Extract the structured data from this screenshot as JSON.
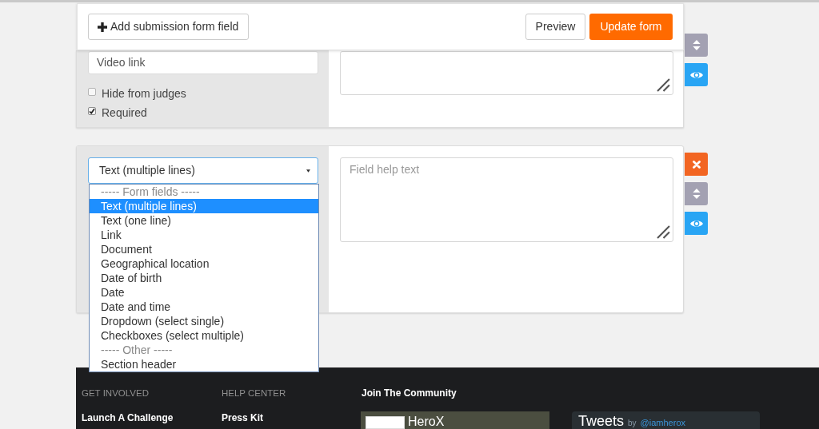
{
  "toolbar": {
    "add_field_button": "Add submission form field",
    "preview_button": "Preview",
    "update_button": "Update form"
  },
  "fields": [
    {
      "label_input": {
        "value": "Video link"
      },
      "settings": [
        {
          "label": "Hide from judges",
          "checked": false
        },
        {
          "label": "Required",
          "checked": true
        }
      ],
      "actions": [
        {
          "kind": "move"
        },
        {
          "kind": "visibility"
        }
      ]
    },
    {
      "type_select": {
        "value": "Text (multiple lines)",
        "expanded": true,
        "options": [
          {
            "kind": "group",
            "label": "----- Form fields -----",
            "selected": false
          },
          {
            "kind": "option",
            "label": "Text (multiple lines)",
            "selected": true
          },
          {
            "kind": "option",
            "label": "Text (one line)",
            "selected": false
          },
          {
            "kind": "option",
            "label": "Link",
            "selected": false
          },
          {
            "kind": "option",
            "label": "Document",
            "selected": false
          },
          {
            "kind": "option",
            "label": "Geographical location",
            "selected": false
          },
          {
            "kind": "option",
            "label": "Date of birth",
            "selected": false
          },
          {
            "kind": "option",
            "label": "Date",
            "selected": false
          },
          {
            "kind": "option",
            "label": "Date and time",
            "selected": false
          },
          {
            "kind": "option",
            "label": "Dropdown (select single)",
            "selected": false
          },
          {
            "kind": "option",
            "label": "Checkboxes (select multiple)",
            "selected": false
          },
          {
            "kind": "group",
            "label": "----- Other -----",
            "selected": false
          },
          {
            "kind": "option",
            "label": "Section header",
            "selected": false
          }
        ]
      },
      "help_text": {
        "placeholder": "Field help text"
      },
      "actions": [
        {
          "kind": "delete"
        },
        {
          "kind": "move"
        },
        {
          "kind": "visibility"
        }
      ]
    }
  ],
  "footer": {
    "columns": [
      {
        "heading": "GET INVOLVED",
        "links": [
          "Launch A Challenge"
        ]
      },
      {
        "heading": "HELP CENTER",
        "links": [
          "Press Kit"
        ]
      }
    ],
    "community": {
      "heading": "Join The Community",
      "page_widget": {
        "name": "HeroX"
      },
      "tweets_widget": {
        "title": "Tweets",
        "by": "by",
        "handle": "@iamherox"
      }
    }
  }
}
